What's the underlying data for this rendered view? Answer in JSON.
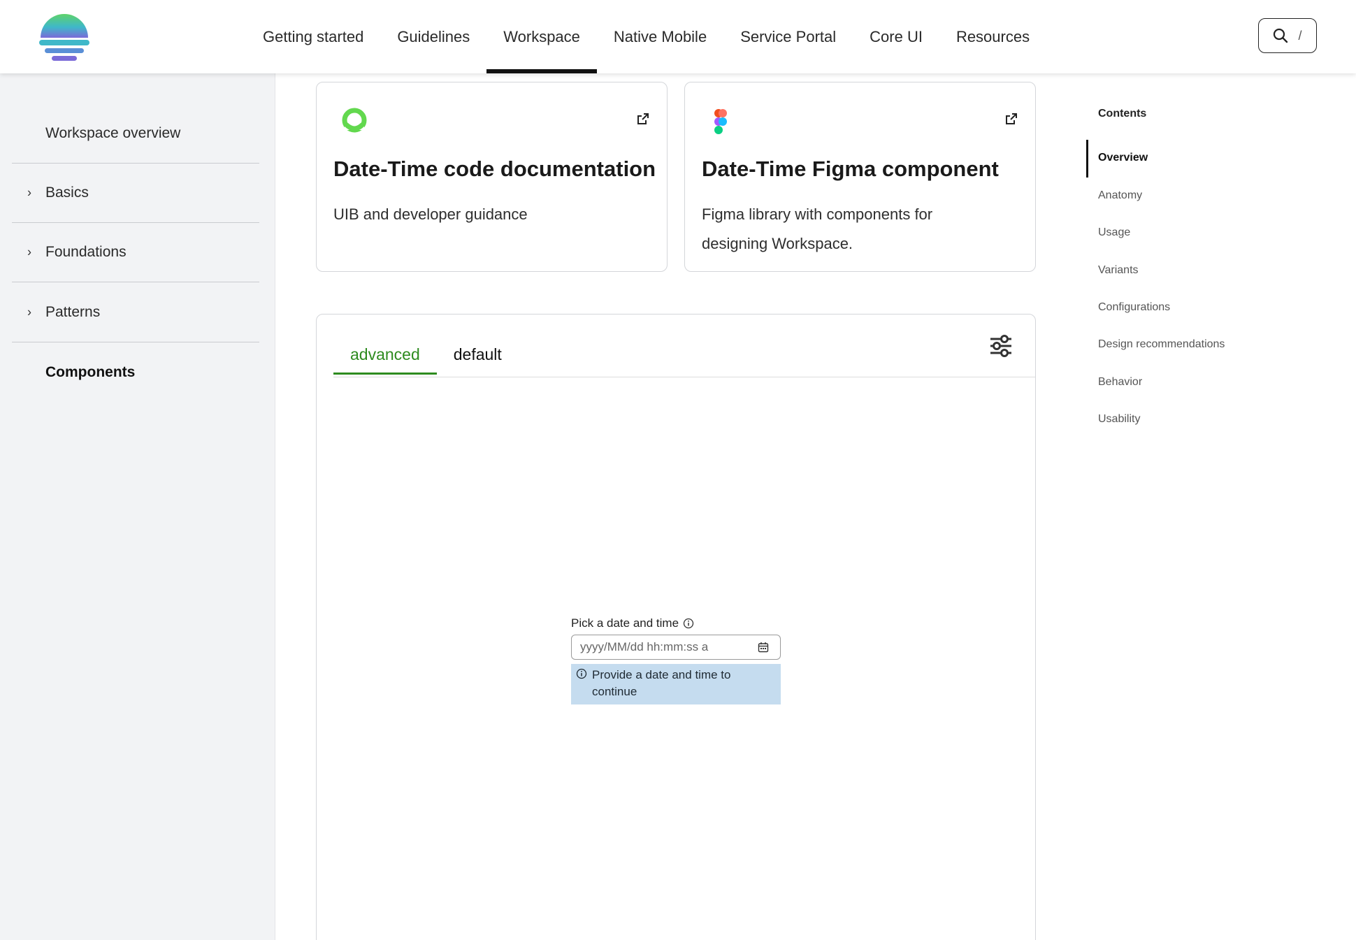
{
  "brand": {
    "logo_icon": "sunset-logo-icon"
  },
  "nav": {
    "items": [
      "Getting started",
      "Guidelines",
      "Workspace",
      "Native Mobile",
      "Service Portal",
      "Core UI",
      "Resources"
    ],
    "active": "Workspace"
  },
  "search": {
    "icon": "search-icon",
    "shortcut": "/"
  },
  "sidebar": {
    "overview": "Workspace overview",
    "items": [
      {
        "label": "Basics",
        "icon": "chevron-right-icon"
      },
      {
        "label": "Foundations",
        "icon": "chevron-right-icon"
      },
      {
        "label": "Patterns",
        "icon": "chevron-right-icon"
      }
    ],
    "components": "Components"
  },
  "cards": [
    {
      "icon": "servicenow-ring-icon",
      "title": "Date-Time code documentation",
      "description": "UIB and developer guidance",
      "link_icon": "external-link-icon"
    },
    {
      "icon": "figma-icon",
      "title": "Date-Time Figma component",
      "description": "Figma library with components for designing Workspace.",
      "link_icon": "external-link-icon"
    }
  ],
  "demo": {
    "tabs": [
      "advanced",
      "default"
    ],
    "active_tab": "advanced",
    "settings_icon": "sliders-icon",
    "field_label": "Pick a date and time",
    "placeholder": "yyyy/MM/dd hh:mm:ss a",
    "message": "Provide a date and time to continue"
  },
  "toc": {
    "title": "Contents",
    "items": [
      "Overview",
      "Anatomy",
      "Usage",
      "Variants",
      "Configurations",
      "Design recommendations",
      "Behavior",
      "Usability"
    ],
    "active": "Overview"
  },
  "colors": {
    "tab_active": "#2e8b1f",
    "message_bg": "#c5dcef",
    "sidebar_bg": "#f2f3f5"
  }
}
